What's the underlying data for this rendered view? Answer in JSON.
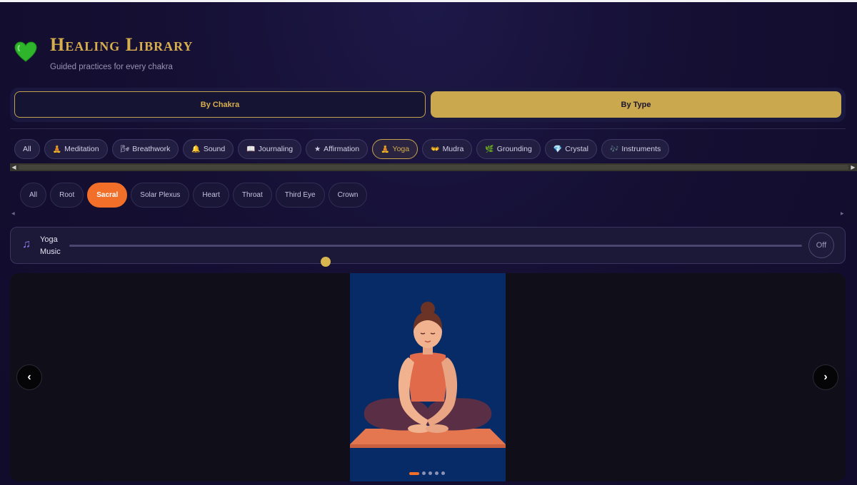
{
  "app": {
    "title": "Healing Library",
    "subtitle": "Guided practices for every chakra",
    "accent_gold": "#d7ae4e",
    "accent_orange": "#f26f2a",
    "logo_icon": "green-heart-icon"
  },
  "mode_toggle": {
    "options": [
      {
        "label": "By Chakra",
        "active": false
      },
      {
        "label": "By Type",
        "active": true
      }
    ]
  },
  "type_filters": [
    {
      "label": "All",
      "icon": ""
    },
    {
      "label": "Meditation",
      "icon": "meditation-icon",
      "glyph": "🧘"
    },
    {
      "label": "Breathwork",
      "icon": "breathwork-icon",
      "glyph": "🌬"
    },
    {
      "label": "Sound",
      "icon": "bell-icon",
      "glyph": "🔔"
    },
    {
      "label": "Journaling",
      "icon": "book-icon",
      "glyph": "📖"
    },
    {
      "label": "Affirmation",
      "icon": "star-icon",
      "glyph": "★"
    },
    {
      "label": "Yoga",
      "icon": "yoga-icon",
      "glyph": "🧘",
      "active": true
    },
    {
      "label": "Mudra",
      "icon": "hands-icon",
      "glyph": "👐"
    },
    {
      "label": "Grounding",
      "icon": "leaf-icon",
      "glyph": "🌿"
    },
    {
      "label": "Crystal",
      "icon": "crystal-icon",
      "glyph": "💎"
    },
    {
      "label": "Instruments",
      "icon": "music-icon",
      "glyph": "🎶"
    }
  ],
  "chakra_filters": [
    {
      "label": "All"
    },
    {
      "label": "Root"
    },
    {
      "label": "Sacral",
      "active": true
    },
    {
      "label": "Solar Plexus"
    },
    {
      "label": "Heart"
    },
    {
      "label": "Throat"
    },
    {
      "label": "Third Eye"
    },
    {
      "label": "Crown"
    }
  ],
  "music": {
    "label": "Yoga Music",
    "icon": "music-note-icon",
    "volume_fraction": 0.35,
    "toggle_label": "Off"
  },
  "carousel": {
    "prev_label": "‹",
    "next_label": "›",
    "slide_count": 5,
    "current_slide": 1,
    "slide_image": "woman-seated-cross-legged-yoga-illustration"
  }
}
